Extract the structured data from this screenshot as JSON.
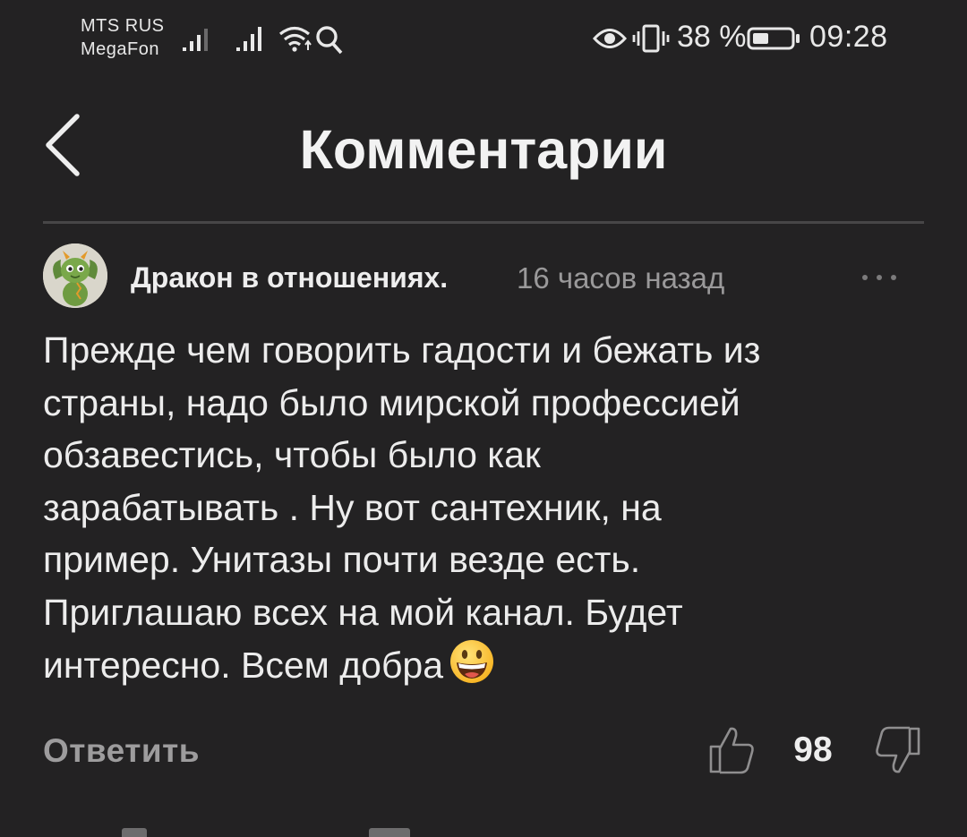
{
  "status_bar": {
    "carrier_1": "MTS RUS",
    "carrier_2": "MegaFon",
    "battery_percent": "38 %",
    "time": "09:28",
    "icons": [
      "signal-icon",
      "signal-icon",
      "wifi-icon",
      "search-icon",
      "eye-icon",
      "vibrate-icon",
      "battery-icon"
    ]
  },
  "header": {
    "title": "Комментарии",
    "back_icon": "chevron-left-icon"
  },
  "comment": {
    "author": "Дракон в отношениях.",
    "timestamp": "16 часов назад",
    "more_icon": "more-dots-icon",
    "text_lines": [
      "Прежде чем говорить гадости и бежать из",
      "страны, надо было мирской профессией",
      "обзавестись, чтобы было как",
      "зарабатывать . Ну вот сантехник, на",
      "пример. Унитазы почти везде есть.",
      "Приглашаю всех на мой канал. Будет",
      "интересно. Всем добра"
    ],
    "emoji": "grinning-face-emoji",
    "reply_label": "Ответить",
    "like_count": "98",
    "like_icon": "thumbs-up-icon",
    "dislike_icon": "thumbs-down-icon"
  },
  "colors": {
    "background": "#232223",
    "text_primary": "#ececec",
    "text_secondary": "#9a999a",
    "divider": "#474647"
  }
}
